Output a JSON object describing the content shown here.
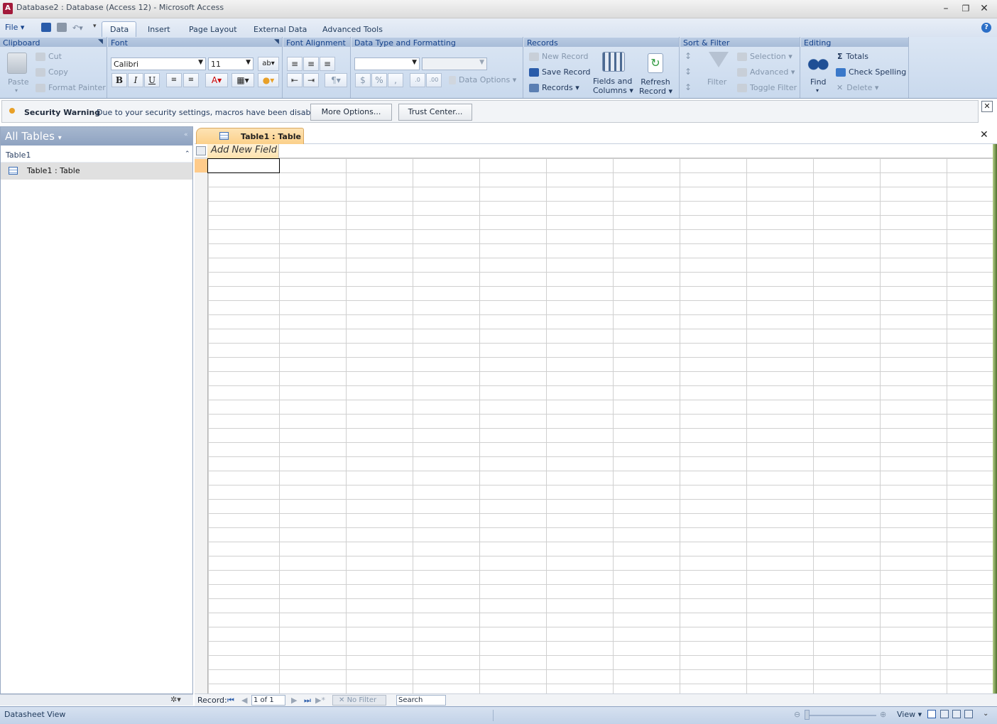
{
  "window": {
    "title": "Database2 : Database (Access 12) - Microsoft Access"
  },
  "ribbon": {
    "file_menu": "File",
    "tabs": [
      "Data",
      "Insert",
      "Page Layout",
      "External Data",
      "Advanced Tools"
    ],
    "groups": {
      "clipboard": {
        "title": "Clipboard",
        "paste": "Paste",
        "cut": "Cut",
        "copy": "Copy",
        "format_painter": "Format Painter"
      },
      "font": {
        "title": "Font",
        "font_name": "Calibri",
        "font_size": "11",
        "bold": "B",
        "italic": "I",
        "underline": "U"
      },
      "font_alignment": {
        "title": "Font Alignment"
      },
      "data_type": {
        "title": "Data Type and Formatting",
        "data_options": "Data Options",
        "currency": "$",
        "percent": "%",
        "comma": ","
      },
      "records": {
        "title": "Records",
        "new_record": "New Record",
        "save_record": "Save Record",
        "records": "Records",
        "fields_columns_1": "Fields and",
        "fields_columns_2": "Columns",
        "refresh_1": "Refresh",
        "refresh_2": "Record"
      },
      "sort_filter": {
        "title": "Sort & Filter",
        "filter": "Filter",
        "selection": "Selection",
        "advanced": "Advanced",
        "toggle_filter": "Toggle Filter"
      },
      "editing": {
        "title": "Editing",
        "find": "Find",
        "totals": "Totals",
        "check_spelling": "Check Spelling",
        "delete": "Delete"
      }
    }
  },
  "security": {
    "title": "Security Warning",
    "message": "Due to your security settings, macros have been disabled.",
    "more_options": "More Options...",
    "trust_center": "Trust Center..."
  },
  "nav_pane": {
    "header": "All Tables",
    "group": "Table1",
    "items": [
      "Table1 : Table"
    ]
  },
  "document": {
    "tab_label": "Table1 : Table",
    "add_field": "Add New Field"
  },
  "record_nav": {
    "label": "Record:",
    "position": "1 of 1",
    "filter": "No Filter",
    "search": "Search"
  },
  "status": {
    "view_name": "Datasheet View",
    "view_label": "View"
  }
}
